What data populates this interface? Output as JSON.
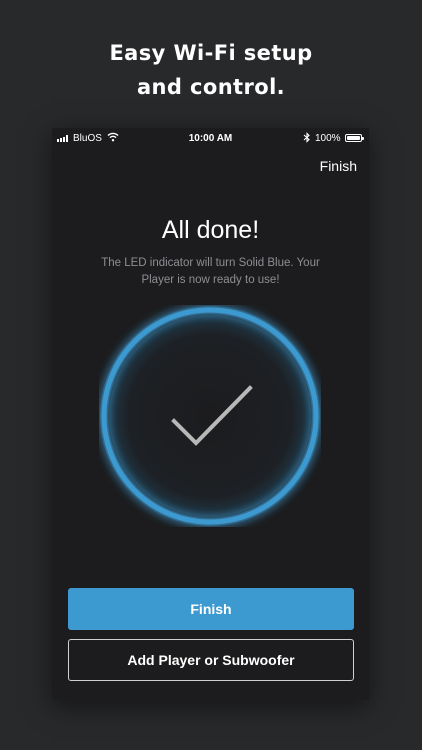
{
  "promo": {
    "line1": "Easy Wi-Fi setup",
    "line2": "and control."
  },
  "status_bar": {
    "carrier": "BluOS",
    "time": "10:00 AM",
    "battery_percent": "100%",
    "icons": [
      "signal-icon",
      "wifi-icon",
      "bluetooth-icon",
      "battery-icon"
    ]
  },
  "header": {
    "finish_link": "Finish"
  },
  "main": {
    "title": "All done!",
    "subtitle": "The LED indicator will turn Solid Blue. Your Player is now ready to use!",
    "status_icon": "checkmark-icon"
  },
  "actions": {
    "primary_label": "Finish",
    "secondary_label": "Add Player or Subwoofer"
  },
  "colors": {
    "accent": "#3d9ad1",
    "background": "#28292b",
    "screen": "#1c1c1e",
    "muted_text": "#8e8e93"
  }
}
